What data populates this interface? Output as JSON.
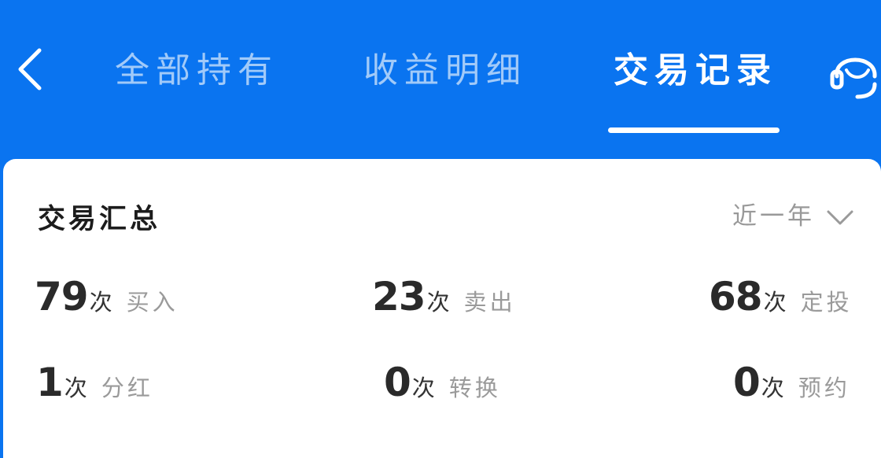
{
  "header": {
    "tabs": [
      {
        "label": "全部持有",
        "active": false
      },
      {
        "label": "收益明细",
        "active": false
      },
      {
        "label": "交易记录",
        "active": true
      }
    ],
    "icons": {
      "back": "chevron-left-icon",
      "service": "customer-service-icon"
    }
  },
  "summary": {
    "title": "交易汇总",
    "period": "近一年",
    "unit": "次",
    "stats": [
      {
        "count": "79",
        "label": "买入"
      },
      {
        "count": "23",
        "label": "卖出"
      },
      {
        "count": "68",
        "label": "定投"
      },
      {
        "count": "1",
        "label": "分红"
      },
      {
        "count": "0",
        "label": "转换"
      },
      {
        "count": "0",
        "label": "预约"
      }
    ]
  },
  "colors": {
    "brand": "#0a74f0",
    "card": "#ffffff",
    "muted": "#999999"
  }
}
